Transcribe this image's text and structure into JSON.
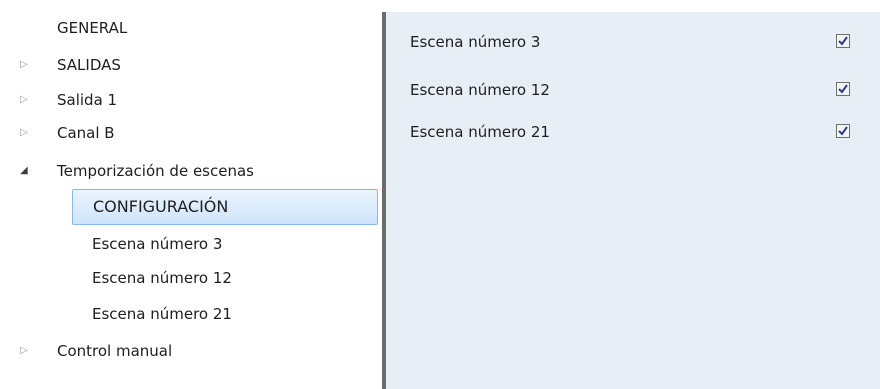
{
  "tree": {
    "items": [
      {
        "label": "GENERAL"
      },
      {
        "label": "SALIDAS"
      },
      {
        "label": "Salida 1"
      },
      {
        "label": "Canal B"
      },
      {
        "label": "Temporización de escenas"
      },
      {
        "label": "Control manual"
      }
    ],
    "children": [
      {
        "label": "CONFIGURACIÓN"
      },
      {
        "label": "Escena número 3"
      },
      {
        "label": "Escena número 12"
      },
      {
        "label": "Escena número 21"
      }
    ]
  },
  "params": [
    {
      "label": "Escena número 3",
      "checked": true
    },
    {
      "label": "Escena número 12",
      "checked": true
    },
    {
      "label": "Escena número 21",
      "checked": true
    }
  ],
  "icons": {
    "collapsed": "triangle-right-outline-icon",
    "expanded": "triangle-down-filled-icon",
    "check": "checkmark-icon"
  },
  "colors": {
    "content_bg": "#e8eef6",
    "selection_border": "#84b9ef",
    "check_color": "#2a3c8c"
  }
}
